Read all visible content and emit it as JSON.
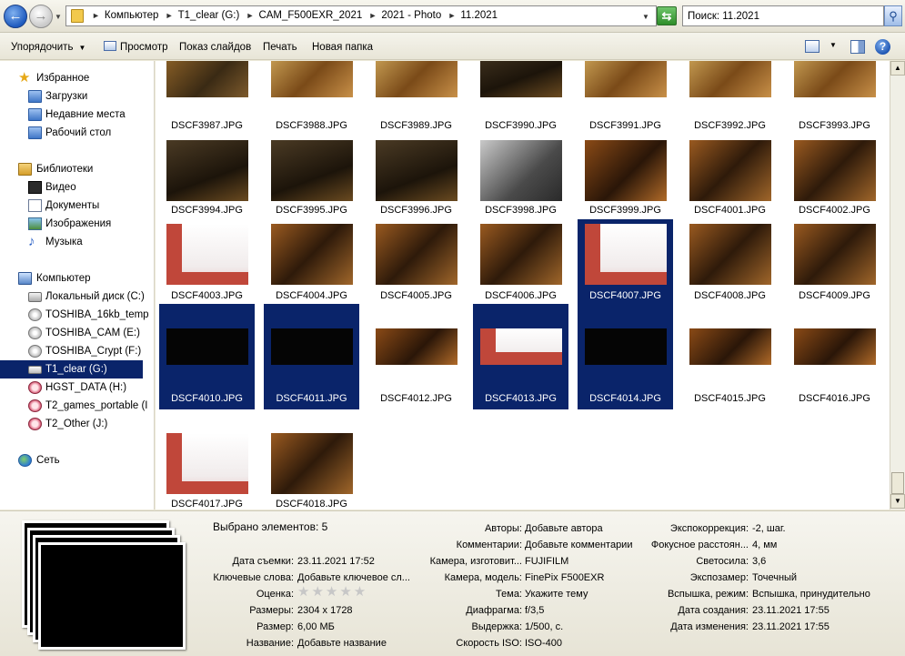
{
  "address": {
    "crumbs": [
      "Компьютер",
      "T1_clear (G:)",
      "CAM_F500EXR_2021",
      "2021 - Photo",
      "11.2021"
    ]
  },
  "search": {
    "value": "Поиск: 11.2021"
  },
  "toolbar": {
    "organize": "Упорядочить",
    "preview": "Просмотр",
    "slideshow": "Показ слайдов",
    "print": "Печать",
    "new_folder": "Новая папка"
  },
  "nav": {
    "favorites": "Избранное",
    "downloads": "Загрузки",
    "recent": "Недавние места",
    "desktop": "Рабочий стол",
    "libraries": "Библиотеки",
    "video": "Видео",
    "documents": "Документы",
    "images": "Изображения",
    "music": "Музыка",
    "computer": "Компьютер",
    "drive_c": "Локальный диск (C:)",
    "drive_toshiba16": "TOSHIBA_16kb_temp",
    "drive_e": "TOSHIBA_CAM (E:)",
    "drive_f": "TOSHIBA_Crypt (F:)",
    "drive_g": "T1_clear (G:)",
    "drive_h": "HGST_DATA (H:)",
    "drive_i": "T2_games_portable (I",
    "drive_j": "T2_Other (J:)",
    "network": "Сеть"
  },
  "files": [
    {
      "name": "DSCF3987.JPG",
      "selected": false
    },
    {
      "name": "DSCF3988.JPG",
      "selected": false
    },
    {
      "name": "DSCF3989.JPG",
      "selected": false
    },
    {
      "name": "DSCF3990.JPG",
      "selected": false
    },
    {
      "name": "DSCF3991.JPG",
      "selected": false
    },
    {
      "name": "DSCF3992.JPG",
      "selected": false
    },
    {
      "name": "DSCF3993.JPG",
      "selected": false
    },
    {
      "name": "DSCF3994.JPG",
      "selected": false
    },
    {
      "name": "DSCF3995.JPG",
      "selected": false
    },
    {
      "name": "DSCF3996.JPG",
      "selected": false
    },
    {
      "name": "DSCF3998.JPG",
      "selected": false
    },
    {
      "name": "DSCF3999.JPG",
      "selected": false
    },
    {
      "name": "DSCF4001.JPG",
      "selected": false
    },
    {
      "name": "DSCF4002.JPG",
      "selected": false
    },
    {
      "name": "DSCF4003.JPG",
      "selected": false
    },
    {
      "name": "DSCF4004.JPG",
      "selected": false
    },
    {
      "name": "DSCF4005.JPG",
      "selected": false
    },
    {
      "name": "DSCF4006.JPG",
      "selected": false
    },
    {
      "name": "DSCF4007.JPG",
      "selected": true
    },
    {
      "name": "DSCF4008.JPG",
      "selected": false
    },
    {
      "name": "DSCF4009.JPG",
      "selected": false
    },
    {
      "name": "DSCF4010.JPG",
      "selected": true
    },
    {
      "name": "DSCF4011.JPG",
      "selected": true
    },
    {
      "name": "DSCF4012.JPG",
      "selected": false
    },
    {
      "name": "DSCF4013.JPG",
      "selected": true
    },
    {
      "name": "DSCF4014.JPG",
      "selected": true
    },
    {
      "name": "DSCF4015.JPG",
      "selected": false
    },
    {
      "name": "DSCF4016.JPG",
      "selected": false
    },
    {
      "name": "DSCF4017.JPG",
      "selected": false
    },
    {
      "name": "DSCF4018.JPG",
      "selected": false
    }
  ],
  "details": {
    "selected_count": "Выбрано элементов: 5",
    "col1": [
      {
        "label": "Дата съемки:",
        "value": "23.11.2021 17:52"
      },
      {
        "label": "Ключевые слова:",
        "value": "Добавьте ключевое сл..."
      },
      {
        "label": "Оценка:",
        "value": ""
      },
      {
        "label": "Размеры:",
        "value": "2304 x 1728"
      },
      {
        "label": "Размер:",
        "value": "6,00 МБ"
      },
      {
        "label": "Название:",
        "value": "Добавьте название"
      }
    ],
    "rating": "★★★★★",
    "col2": [
      {
        "label": "Авторы:",
        "value": "Добавьте автора"
      },
      {
        "label": "Комментарии:",
        "value": "Добавьте комментарии"
      },
      {
        "label": "Камера, изготовит...",
        "value": "FUJIFILM"
      },
      {
        "label": "Камера, модель:",
        "value": "FinePix F500EXR"
      },
      {
        "label": "Тема:",
        "value": "Укажите тему"
      },
      {
        "label": "Диафрагма:",
        "value": "f/3,5"
      },
      {
        "label": "Выдержка:",
        "value": "1/500, с."
      },
      {
        "label": "Скорость ISO:",
        "value": "ISO-400"
      }
    ],
    "col3": [
      {
        "label": "Экспокоррекция:",
        "value": "-2, шаг."
      },
      {
        "label": "Фокусное расстоян...",
        "value": "4, мм"
      },
      {
        "label": "Светосила:",
        "value": "3,6"
      },
      {
        "label": "Экспозамер:",
        "value": "Точечный"
      },
      {
        "label": "Вспышка, режим:",
        "value": "Вспышка, принудительно"
      },
      {
        "label": "Дата создания:",
        "value": "23.11.2021 17:55"
      },
      {
        "label": "Дата изменения:",
        "value": "23.11.2021 17:55"
      }
    ]
  }
}
